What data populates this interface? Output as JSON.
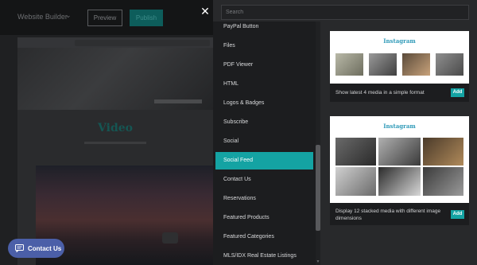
{
  "topbar": {
    "builder_name": "Website Builder",
    "preview_label": "Preview",
    "publish_label": "Publish"
  },
  "background": {
    "video_title": "Video"
  },
  "contact": {
    "label": "Contact Us"
  },
  "close": {
    "glyph": "✕"
  },
  "search": {
    "placeholder": "Search",
    "value": ""
  },
  "elements": {
    "items": [
      {
        "label": "PayPal Button",
        "active": false
      },
      {
        "label": "Files",
        "active": false
      },
      {
        "label": "PDF Viewer",
        "active": false
      },
      {
        "label": "HTML",
        "active": false
      },
      {
        "label": "Logos & Badges",
        "active": false
      },
      {
        "label": "Subscribe",
        "active": false
      },
      {
        "label": "Social",
        "active": false
      },
      {
        "label": "Social Feed",
        "active": true
      },
      {
        "label": "Contact Us",
        "active": false
      },
      {
        "label": "Reservations",
        "active": false
      },
      {
        "label": "Featured Products",
        "active": false
      },
      {
        "label": "Featured Categories",
        "active": false
      },
      {
        "label": "MLS/IDX Real Estate Listings",
        "active": false
      }
    ]
  },
  "layouts": [
    {
      "title": "Instagram",
      "description": "Show latest 4 media in a simple format",
      "add_label": "Add"
    },
    {
      "title": "Instagram",
      "description": "Display 12 stacked media with different image dimensions",
      "add_label": "Add"
    }
  ],
  "colors": {
    "accent": "#14a3a3",
    "panel": "#28292b",
    "list": "#1c1d1f",
    "contact": "#4b5fa8",
    "instagram_title": "#2f9ab8"
  }
}
